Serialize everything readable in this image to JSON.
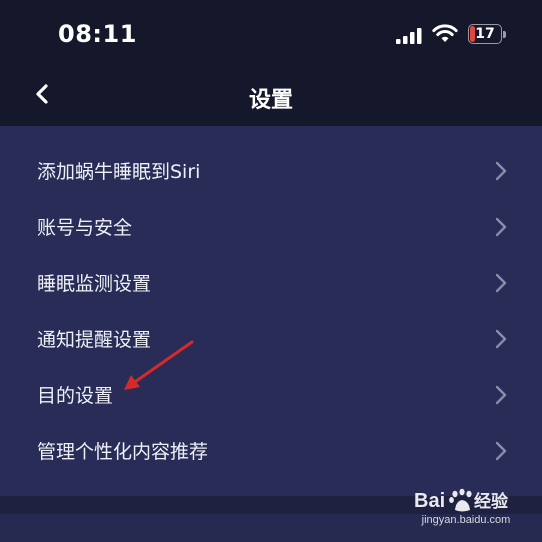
{
  "status_bar": {
    "time": "08:11",
    "battery_level": "17",
    "battery_color": "#e5453f"
  },
  "nav": {
    "back_icon": "chevron-left-icon",
    "title": "设置"
  },
  "settings": {
    "items": [
      {
        "label": "添加蜗牛睡眠到Siri"
      },
      {
        "label": "账号与安全"
      },
      {
        "label": "睡眠监测设置"
      },
      {
        "label": "通知提醒设置"
      },
      {
        "label": "目的设置"
      },
      {
        "label": "管理个性化内容推荐"
      }
    ],
    "chevron_icon": "chevron-right-icon"
  },
  "annotation": {
    "arrow_color": "#d42a2a",
    "arrow_target": "目的设置"
  },
  "watermark": {
    "brand_text": "Bai",
    "brand_suffix": "经验",
    "url": "jingyan.baidu.com"
  },
  "colors": {
    "header_bg": "#15182a",
    "list_bg": "#282c56",
    "text": "#eef0f6",
    "chevron": "#8a8ca8"
  }
}
